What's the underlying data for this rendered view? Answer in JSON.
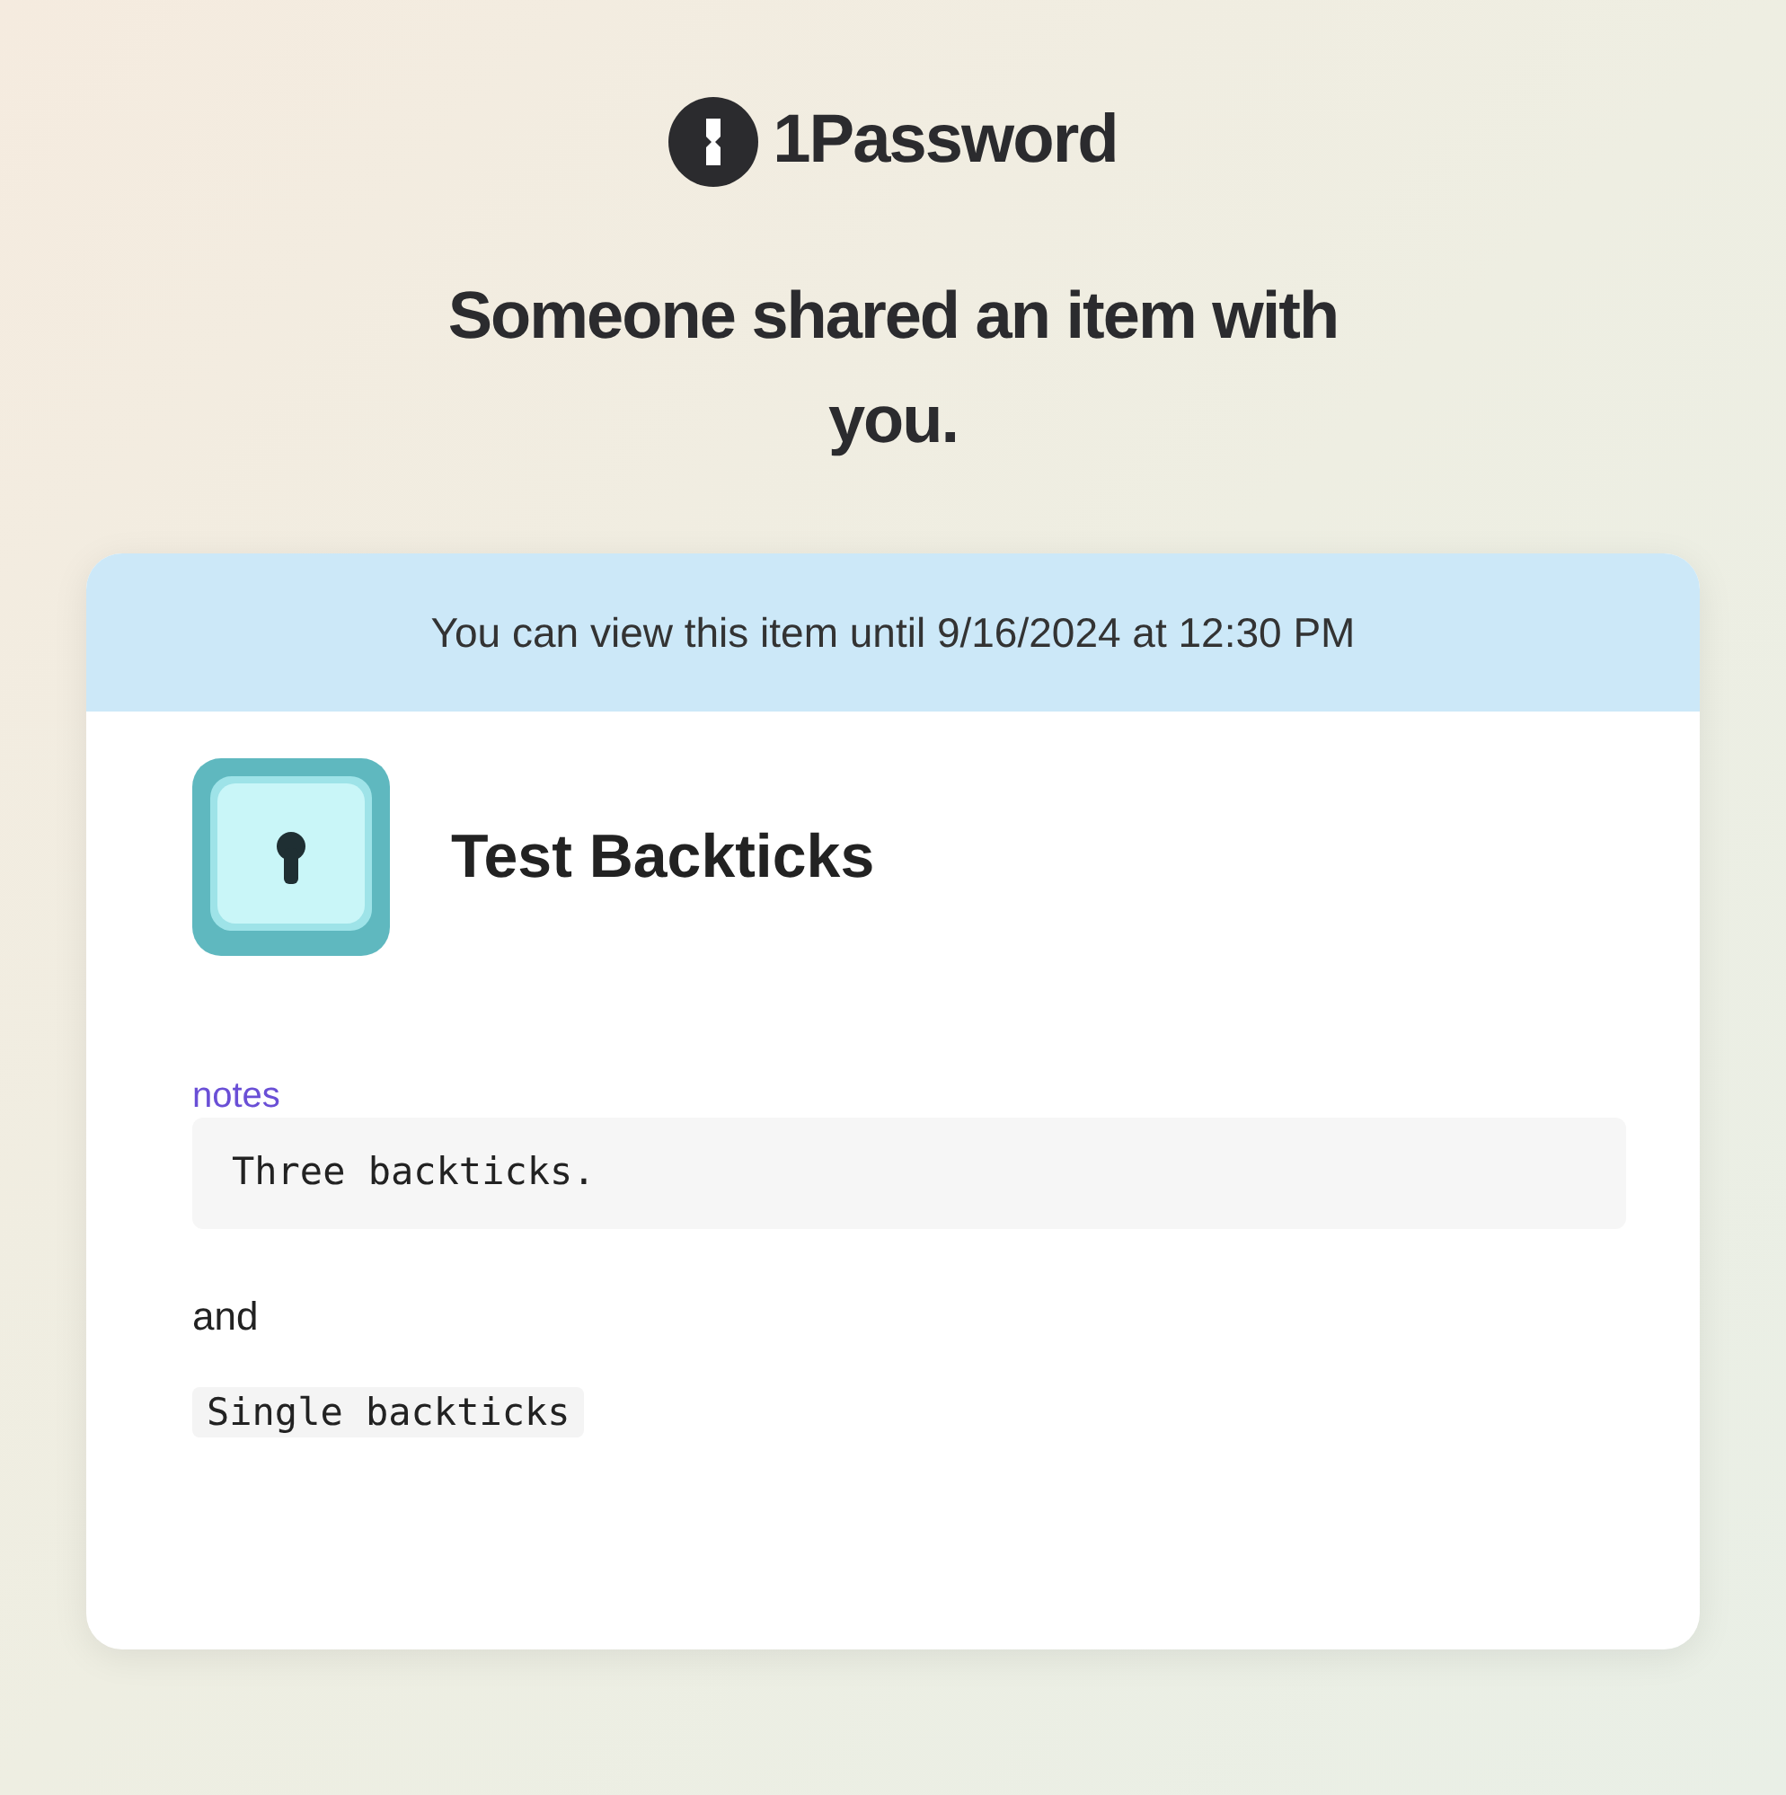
{
  "logo": {
    "text": "1Password"
  },
  "heading": "Someone shared an item with you.",
  "card": {
    "banner": "You can view this item until 9/16/2024 at 12:30 PM",
    "item_title": "Test Backticks",
    "field_label": "notes",
    "notes": [
      {
        "kind": "code_block",
        "text": "Three backticks."
      },
      {
        "kind": "paragraph",
        "text": "and"
      },
      {
        "kind": "inline_code",
        "text": "Single backticks"
      }
    ]
  }
}
